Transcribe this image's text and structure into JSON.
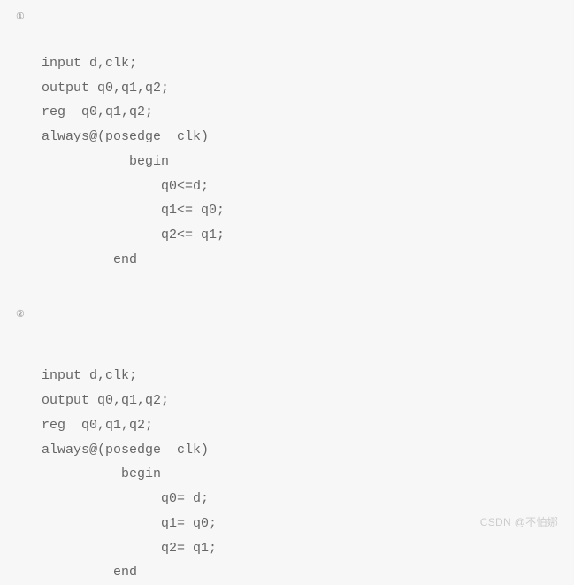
{
  "marker1": "①",
  "block1": {
    "l1": "input d,clk;",
    "l2": "output q0,q1,q2;",
    "l3": "reg  q0,q1,q2;",
    "l4": "always@(posedge  clk)",
    "l5": "           begin",
    "l6": "               q0<=d;",
    "l7": "               q1<= q0;",
    "l8": "               q2<= q1;",
    "l9": "         end"
  },
  "marker2": "②",
  "block2": {
    "l1": "input d,clk;",
    "l2": "output q0,q1,q2;",
    "l3": "reg  q0,q1,q2;",
    "l4": "always@(posedge  clk)",
    "l5": "          begin",
    "l6": "               q0= d;",
    "l7": "               q1= q0;",
    "l8": "               q2= q1;",
    "l9": "         end"
  },
  "watermark": "CSDN @不怕娜"
}
